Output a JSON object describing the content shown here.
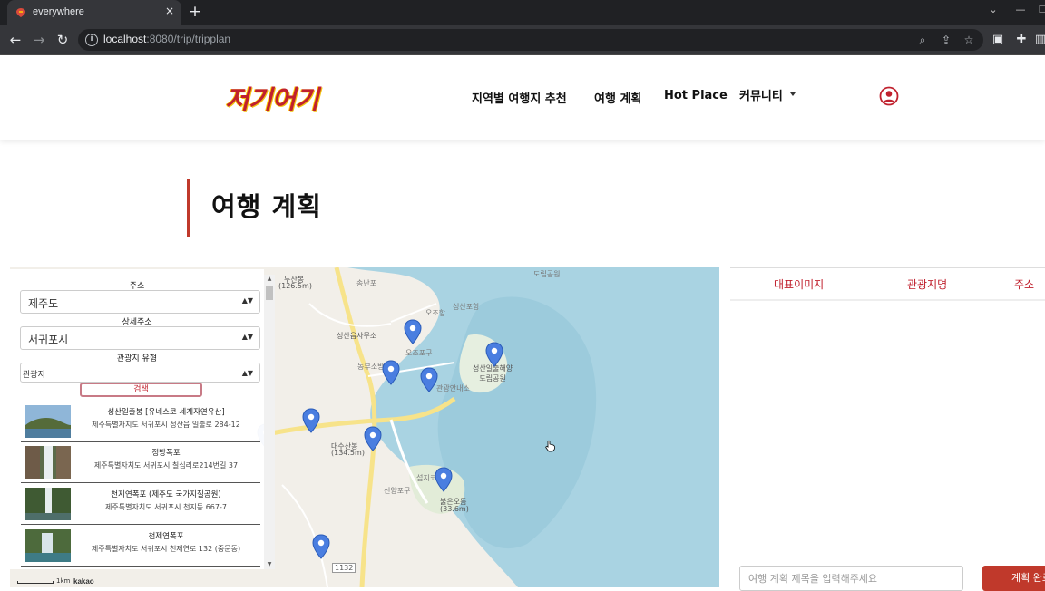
{
  "browser": {
    "tab_title": "everywhere",
    "tab_close": "×",
    "new_tab": "+",
    "url_host": "localhost",
    "url_rest": ":8080/trip/tripplan",
    "nav": {
      "back": "←",
      "forward": "→",
      "reload": "↻"
    },
    "omnibox_icons": [
      "zoom-icon",
      "share-icon",
      "bookmark-star-icon"
    ],
    "extension_icons": [
      "tab-search-icon",
      "extensions-puzzle-icon",
      "sidebar-icon"
    ],
    "window_controls": {
      "minimize": "⌄",
      "min": "—",
      "restore": "❐"
    }
  },
  "site": {
    "logo_text": "저기어기",
    "nav": [
      {
        "label": "지역별 여행지 추천"
      },
      {
        "label": "여행 계획"
      },
      {
        "label": "Hot Place"
      },
      {
        "label": "커뮤니티"
      }
    ],
    "accent_color": "#c0212e"
  },
  "page": {
    "title": "여행 계획"
  },
  "search_panel": {
    "address_label": "주소",
    "address_value": "제주도",
    "detail_label": "상세주소",
    "detail_value": "서귀포시",
    "type_label": "관광지 유형",
    "type_value": "관광지",
    "search_button": "검색",
    "results": [
      {
        "name": "성산일출봉 [유네스코 세계자연유산]",
        "address": "제주특별자치도 서귀포시 성산읍 일출로 284-12"
      },
      {
        "name": "정방폭포",
        "address": "제주특별자치도 서귀포시 칠십리로214번길 37"
      },
      {
        "name": "천지연폭포 (제주도 국가지질공원)",
        "address": "제주특별자치도 서귀포시 천지동 667-7"
      },
      {
        "name": "천제연폭포",
        "address": "제주특별자치도 서귀포시 천제연로 132 (중문동)"
      }
    ]
  },
  "map": {
    "attribution": "kakao",
    "scale_label": "1km",
    "labels": {
      "dusanbong": "두산봉",
      "dusanbong_h": "(126.5m)",
      "songnan": "송난포",
      "ojohang": "오조항",
      "seongsanpo": "성산포항",
      "seongsan_office": "성산읍사무소",
      "ojopogu": "오조포구",
      "dongbu": "동부소방",
      "park": "성산일출해양\n도립공원",
      "daesu": "대수산봉",
      "daesu_h": "(134.5m)",
      "sinyangpogu": "신양포구",
      "seopjikoji": "섭지코지",
      "bukeun": "붉은오름",
      "bukeun_h": "(33.6m)",
      "dorip": "도립공원",
      "road": "1132",
      "tourist": "관광안내소"
    }
  },
  "plan_table": {
    "headers": [
      "대표이미지",
      "관광지명",
      "주소"
    ],
    "title_placeholder": "여행 계획 제목을 입력해주세요",
    "done_button": "계획 완료"
  }
}
